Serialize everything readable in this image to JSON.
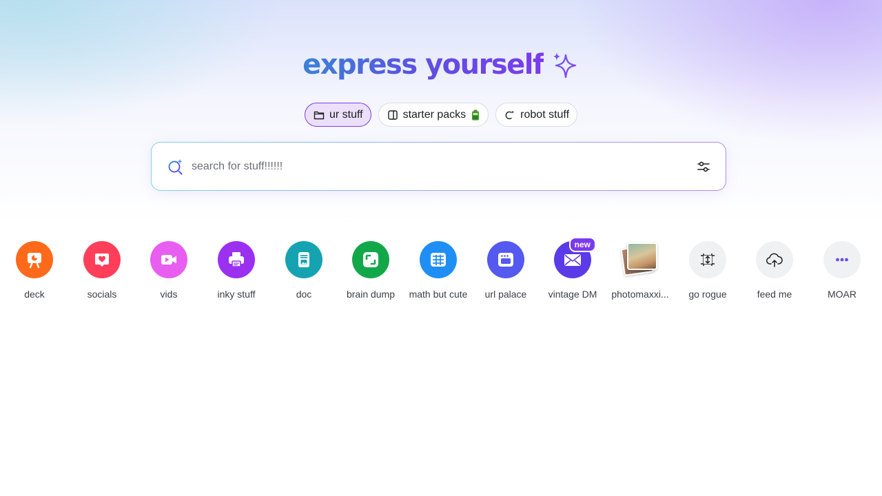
{
  "hero": {
    "title": "express yourself",
    "sparkle_icon": "sparkle-icon"
  },
  "tabs": [
    {
      "label": "ur stuff",
      "icon": "folder-icon",
      "active": true
    },
    {
      "label": "starter packs",
      "icon": "template-icon",
      "suffix_icon": "battery-emoji-icon",
      "active": false
    },
    {
      "label": "robot stuff",
      "icon": "magic-wand-icon",
      "active": false
    }
  ],
  "search": {
    "placeholder": "search for stuff!!!!!!",
    "value": "",
    "icon": "magic-search-icon",
    "filter_icon": "filter-sliders-icon"
  },
  "shortcuts": [
    {
      "label": "deck",
      "color": "#ff6a1a",
      "icon": "presentation-icon"
    },
    {
      "label": "socials",
      "color": "#ff3f5a",
      "icon": "heart-chat-icon"
    },
    {
      "label": "vids",
      "color": "#e85ef0",
      "icon": "video-camera-icon"
    },
    {
      "label": "inky stuff",
      "color": "#9b30f0",
      "icon": "printer-icon"
    },
    {
      "label": "doc",
      "color": "#15a3b1",
      "icon": "document-icon"
    },
    {
      "label": "brain dump",
      "color": "#12a84a",
      "icon": "whiteboard-icon"
    },
    {
      "label": "math but cute",
      "color": "#1f8ff5",
      "icon": "spreadsheet-icon"
    },
    {
      "label": "url palace",
      "color": "#5459f0",
      "icon": "website-icon"
    },
    {
      "label": "vintage DM",
      "color": "#5b3be8",
      "icon": "envelope-icon",
      "badge": "new"
    },
    {
      "label": "photomaxxi...",
      "color": "",
      "icon": "photo-stack-icon"
    },
    {
      "label": "go rogue",
      "color": "#f0f1f3",
      "icon": "custom-size-icon"
    },
    {
      "label": "feed me",
      "color": "#f0f1f3",
      "icon": "cloud-upload-icon"
    },
    {
      "label": "MOAR",
      "color": "#f0f1f3",
      "icon": "more-dots-icon"
    }
  ]
}
